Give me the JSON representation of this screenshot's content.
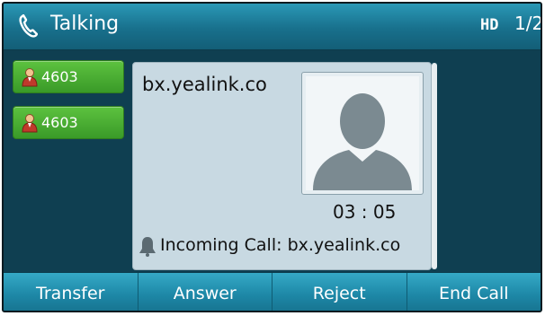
{
  "header": {
    "title": "Talking",
    "hd_badge": "HD",
    "page_indicator": "1/2",
    "status_icon": "handset-icon"
  },
  "line_keys": [
    {
      "label": "4603",
      "icon": "contact-icon"
    },
    {
      "label": "4603",
      "icon": "contact-icon"
    }
  ],
  "call": {
    "remote_name": "bx.yealink.co",
    "timer": "03 : 05",
    "incoming_prefix": "Incoming Call:",
    "incoming_from": "bx.yealink.co",
    "avatar_icon": "person-silhouette-icon",
    "notification_icon": "bell-icon"
  },
  "softkeys": [
    "Transfer",
    "Answer",
    "Reject",
    "End Call"
  ],
  "colors": {
    "header": "#1c7fa0",
    "background": "#0f3f51",
    "line_key": "#4aad33",
    "card": "#c8d9e2",
    "softkey_bar": "#1f8aa9"
  }
}
